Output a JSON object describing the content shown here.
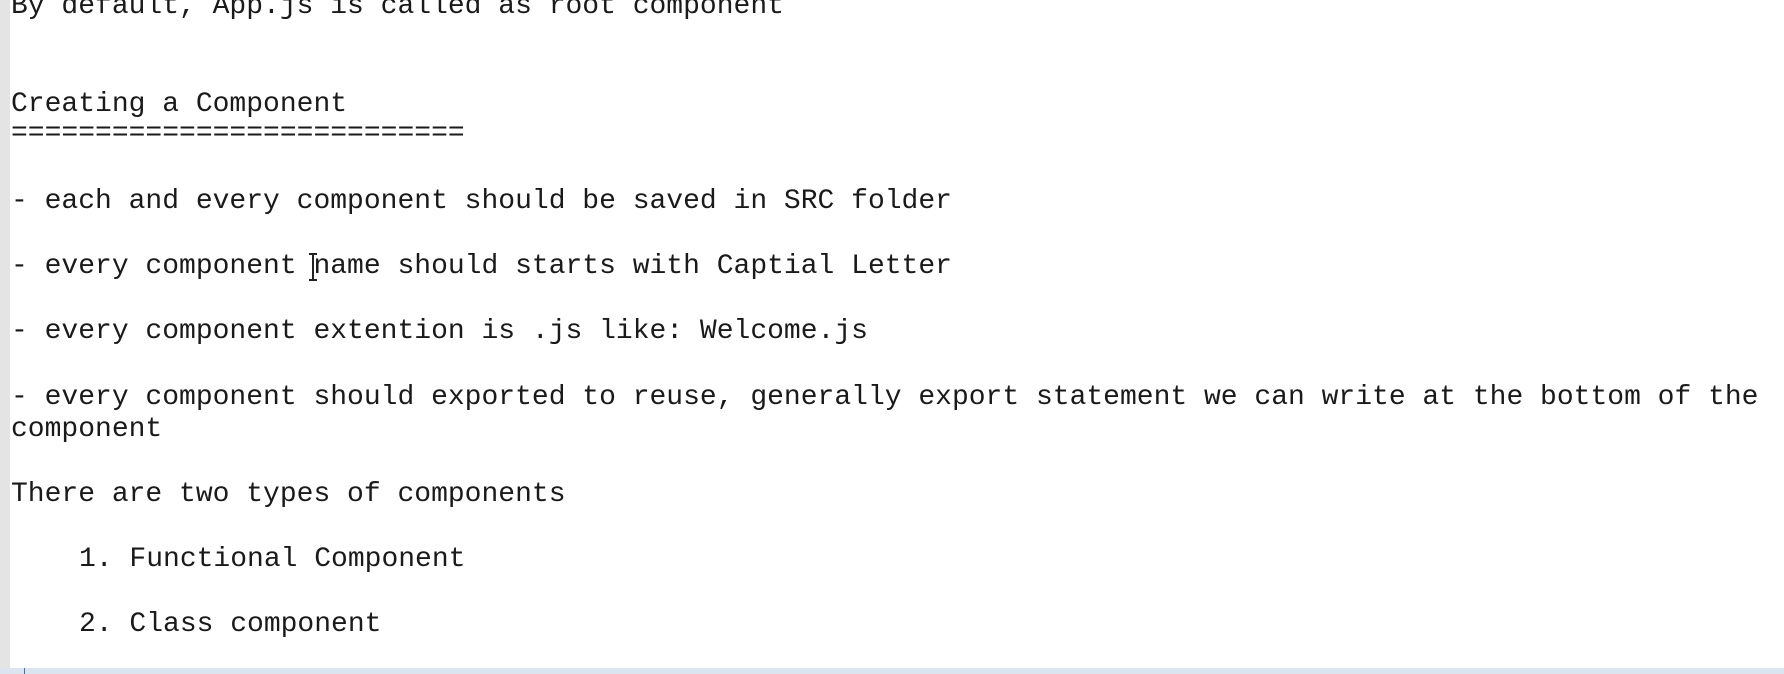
{
  "document": {
    "line_root": "By default, App.js is called as root component",
    "heading": "Creating a Component",
    "underline": "===========================",
    "rule_1": "- each and every component should be saved in SRC folder",
    "rule_2_start": "- every component ",
    "rule_2_end": "name should starts with Captial Letter",
    "rule_3": "- every component extention is .js like: Welcome.js",
    "rule_4a": "- every component should exported to reuse, generally export statement we can write at the bottom of the",
    "rule_4b": "component",
    "types_intro": "There are two types of components",
    "type_1": "1. Functional Component",
    "type_2": "2. Class component"
  }
}
